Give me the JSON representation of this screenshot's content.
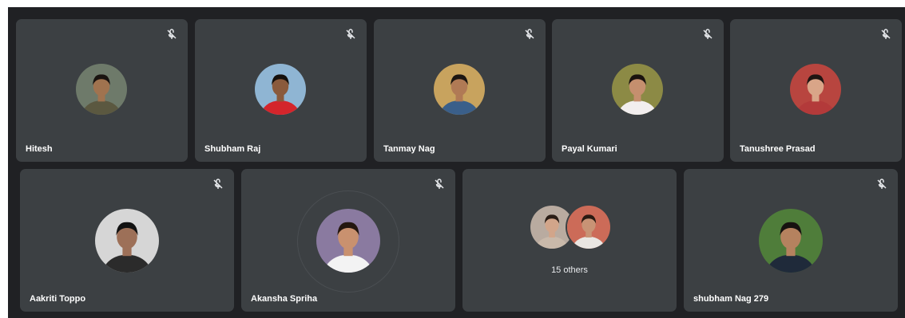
{
  "participants": [
    {
      "name": "Hitesh",
      "muted": true,
      "avatar": {
        "bg": "#6e7a6a",
        "skin": "#a0734f",
        "hair": "#1a1410",
        "shirt": "#5b5840"
      }
    },
    {
      "name": "Shubham Raj",
      "muted": true,
      "avatar": {
        "bg": "#8fb5d3",
        "skin": "#8a5a3c",
        "hair": "#15100c",
        "shirt": "#d4252b"
      }
    },
    {
      "name": "Tanmay Nag",
      "muted": true,
      "avatar": {
        "bg": "#c8a35e",
        "skin": "#b07a55",
        "hair": "#1c1612",
        "shirt": "#3a5f8a"
      }
    },
    {
      "name": "Payal Kumari",
      "muted": true,
      "avatar": {
        "bg": "#8c8a45",
        "skin": "#c58f6e",
        "hair": "#1a120e",
        "shirt": "#f2eeee"
      }
    },
    {
      "name": "Tanushree Prasad",
      "muted": true,
      "avatar": {
        "bg": "#b8453f",
        "skin": "#d9a588",
        "hair": "#201512",
        "shirt": "#b33a3a"
      }
    },
    {
      "name": "Aakriti Toppo",
      "muted": true,
      "avatar": {
        "bg": "#d6d6d6",
        "skin": "#9d7058",
        "hair": "#121212",
        "shirt": "#2b2b2b"
      }
    },
    {
      "name": "Akansha Spriha",
      "muted": true,
      "avatar": {
        "bg": "#8a7aa0",
        "skin": "#c9916f",
        "hair": "#24170f",
        "shirt": "#f3f3f3"
      }
    },
    {
      "name": "shubham Nag 279",
      "muted": true,
      "avatar": {
        "bg": "#4f7d3a",
        "skin": "#b5825f",
        "hair": "#171210",
        "shirt": "#1f2a3a"
      }
    }
  ],
  "others": {
    "label": "15 others",
    "avatars": [
      {
        "bg": "#b9aba0",
        "skin": "#d2a58a",
        "hair": "#2a1d16",
        "shirt": "#c9b9aa"
      },
      {
        "bg": "#cc6b58",
        "skin": "#c89375",
        "hair": "#2a1a12",
        "shirt": "#e9e6e2"
      }
    ]
  },
  "colors": {
    "stage": "#202124",
    "tile": "#3c4043",
    "text": "#ffffff"
  },
  "icons": {
    "muted": "mic-off-icon"
  }
}
